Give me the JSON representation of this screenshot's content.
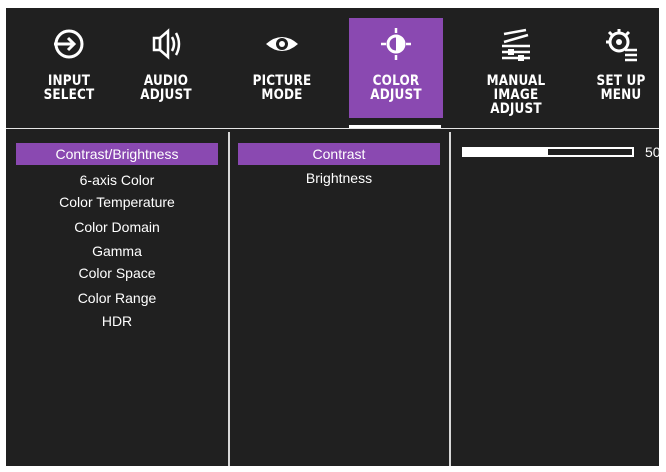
{
  "tabs": [
    {
      "label": "INPUT\nSELECT",
      "icon": "input-select-icon",
      "active": false
    },
    {
      "label": "AUDIO\nADJUST",
      "icon": "audio-adjust-icon",
      "active": false
    },
    {
      "label": "PICTURE\nMODE",
      "icon": "picture-mode-icon",
      "active": false
    },
    {
      "label": "COLOR\nADJUST",
      "icon": "color-adjust-icon",
      "active": true
    },
    {
      "label": "MANUAL\nIMAGE ADJUST",
      "icon": "manual-image-adjust-icon",
      "active": false
    },
    {
      "label": "SET UP\nMENU",
      "icon": "setup-menu-icon",
      "active": false
    }
  ],
  "menu": {
    "items": [
      "Contrast/Brightness",
      "6-axis Color",
      "Color Temperature",
      "Color Domain",
      "Gamma",
      "Color Space",
      "Color Range",
      "HDR"
    ],
    "selected": "Contrast/Brightness"
  },
  "submenu": {
    "items": [
      "Contrast",
      "Brightness"
    ],
    "selected": "Contrast"
  },
  "value": {
    "label": "50",
    "level": 0.5
  },
  "colors": {
    "accent": "#8a49b1",
    "background": "#202020",
    "text": "#ffffff"
  }
}
